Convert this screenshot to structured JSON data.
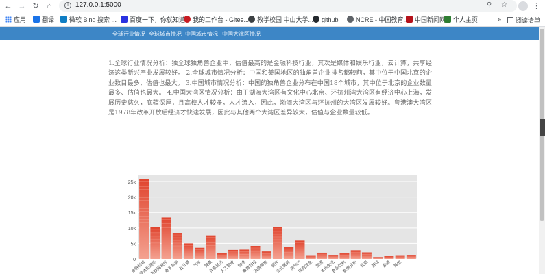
{
  "browser": {
    "url": "127.0.0.1:5000",
    "back_icon": "back-arrow-icon",
    "forward_icon": "forward-arrow-icon",
    "reload_icon": "reload-icon",
    "home_icon": "home-icon"
  },
  "bookmarks": {
    "items": [
      {
        "label": "应用",
        "icon": "apps-icon",
        "color": "#4285f4"
      },
      {
        "label": "翻译",
        "icon": "translate-icon",
        "color": "#1a73e8"
      },
      {
        "label": "微软 Bing 搜索 ...",
        "icon": "bing-icon",
        "color": "#0f7ec4"
      },
      {
        "label": "百度一下，你就知道",
        "icon": "baidu-icon",
        "color": "#2932e1"
      },
      {
        "label": "我的工作台 - Gitee...",
        "icon": "gitee-icon",
        "color": "#c71d23"
      },
      {
        "label": "教学校园 中山大学...",
        "icon": "campus-icon",
        "color": "#3c4043"
      },
      {
        "label": "github",
        "icon": "github-icon",
        "color": "#24292e"
      },
      {
        "label": "NCRE - 中国教育...",
        "icon": "ncre-icon",
        "color": "#3c4043"
      },
      {
        "label": "中国新闻网",
        "icon": "chinanews-icon",
        "color": "#b5121b"
      },
      {
        "label": "个人主页",
        "icon": "homepage-icon",
        "color": "#2e7d32"
      }
    ],
    "reading_list": "阅读清单"
  },
  "page": {
    "nav": [
      "全球行业情况",
      "全球城市情况",
      "中国城市情况",
      "中国大湾区情况"
    ],
    "paragraph": "1.全球行业情况分析：独全球独角兽企业中，估值最高的是金融科技行业，其次是媒体和娱乐行业，云计算，共享经济这类新兴产业发展较好。 2.全球城市情况分析：中国和美国地区的独角兽企业排名都较前，其中位于中国北京的企业数目最多，估值也最大。 3.中国城市情况分析：中国的独角兽企业分布在中国18个城市，其中位于北京的企业数量最多、估值也最大。 4.中国大湾区情况分析：由于湖海大湾区有文化中心北京、环抗州湾大湾区有经济中心上海，发展历史悠久，底蕴深厚，且高校人才较多，人才流入，因此，渤海大湾区与环抗州的大湾区发展较好。粤港澳大湾区是1978年改革开放后经济才快速发展，因此与其他两个大湾区差异较大，估值与企业数量较低。"
  },
  "chart_data": {
    "type": "bar",
    "ylim": [
      0,
      27000
    ],
    "yticks": [
      "0",
      "5k",
      "10k",
      "15k",
      "20k",
      "25k"
    ],
    "categories": [
      "金融科技",
      "媒体和娱乐",
      "互联网软件",
      "电子商务",
      "云计算",
      "汽车",
      "健康",
      "共享经济",
      "人工智能",
      "物流",
      "教育科技",
      "消费零售",
      "硬件",
      "企业服务",
      "房地产",
      "网络安全",
      "旅游",
      "本地生活",
      "食品饮料",
      "数据分析",
      "社交",
      "游戏",
      "能源",
      "其他"
    ],
    "values": [
      25800,
      10200,
      13400,
      8400,
      5000,
      3600,
      7600,
      1800,
      2900,
      3000,
      4200,
      2400,
      10400,
      3900,
      5900,
      1200,
      2000,
      1300,
      1900,
      2800,
      2100,
      600,
      900,
      1200,
      1300
    ],
    "colors": {
      "bar_top": "#e0452f",
      "bar_bottom": "#f4a291",
      "grid_bg": "#e5e5e5"
    }
  }
}
